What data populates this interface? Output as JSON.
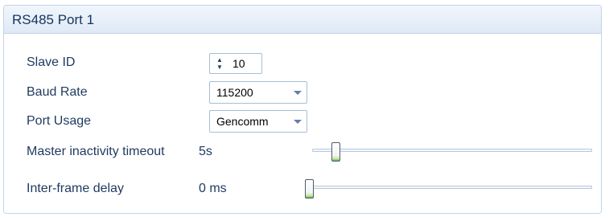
{
  "panel": {
    "title": "RS485 Port 1"
  },
  "fields": {
    "slave_id": {
      "label": "Slave ID",
      "value": "10"
    },
    "baud_rate": {
      "label": "Baud Rate",
      "value": "115200"
    },
    "port_usage": {
      "label": "Port Usage",
      "value": "Gencomm"
    },
    "master_inactivity_timeout": {
      "label": "Master inactivity timeout",
      "value_text": "5s",
      "slider_level": 0.07
    },
    "inter_frame_delay": {
      "label": "Inter-frame delay",
      "value_text": "0 ms",
      "slider_level": 0.0
    }
  },
  "icons": {
    "spinner_up": "up-triangle",
    "spinner_down": "down-triangle",
    "dropdown": "chevron-down-icon"
  },
  "colors": {
    "header_bg": "#dfe9f6",
    "border": "#c3d3e6",
    "text": "#1e3a5f",
    "slider_thumb_accent": "#5fb83f"
  }
}
